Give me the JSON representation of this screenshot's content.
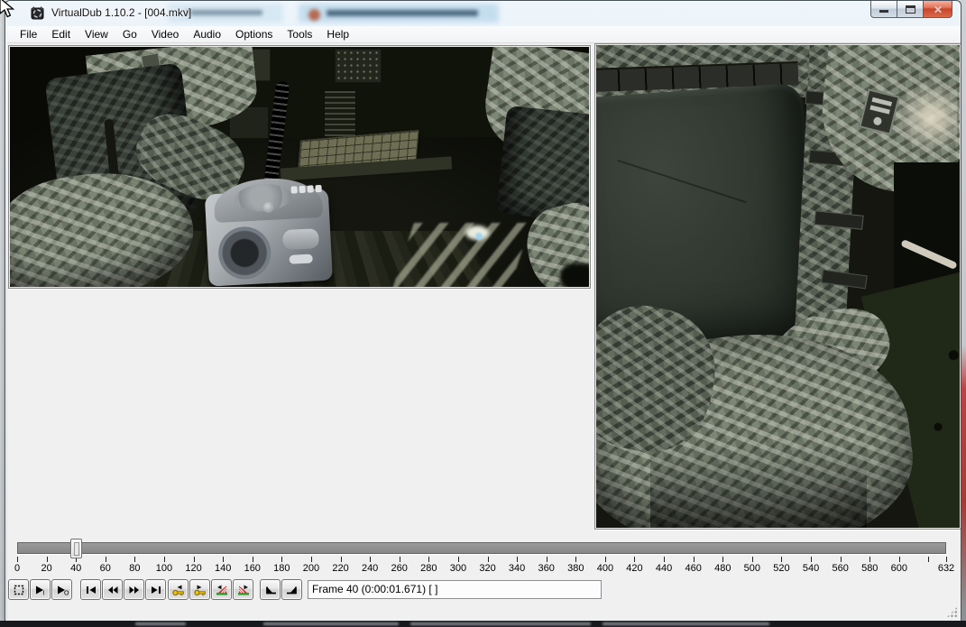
{
  "window": {
    "title": "VirtualDub 1.10.2 - [004.mkv]",
    "controls": {
      "minimize": "Minimize",
      "maximize": "Maximize",
      "close": "Close"
    }
  },
  "menu": {
    "items": [
      "File",
      "Edit",
      "View",
      "Go",
      "Video",
      "Audio",
      "Options",
      "Tools",
      "Help"
    ]
  },
  "timeline": {
    "current_frame": 40,
    "first_frame": 0,
    "last_frame": 632,
    "tick_step": 20,
    "last_step_label": 600,
    "end_label": "632"
  },
  "toolbar": {
    "groups": [
      [
        {
          "name": "stop",
          "icon": "stop-icon"
        },
        {
          "name": "play-input",
          "icon": "play-input-icon",
          "glyph": "I"
        },
        {
          "name": "play-output",
          "icon": "play-output-icon",
          "glyph": "O"
        }
      ],
      [
        {
          "name": "go-to-start",
          "icon": "go-start-icon"
        },
        {
          "name": "step-backward",
          "icon": "step-back-icon"
        },
        {
          "name": "step-forward",
          "icon": "step-forward-icon"
        },
        {
          "name": "go-to-end",
          "icon": "go-end-icon"
        }
      ],
      [
        {
          "name": "previous-keyframe",
          "icon": "key-back-icon"
        },
        {
          "name": "next-keyframe",
          "icon": "key-forward-icon"
        }
      ],
      [
        {
          "name": "previous-scene",
          "icon": "scene-back-icon"
        },
        {
          "name": "next-scene",
          "icon": "scene-forward-icon"
        }
      ],
      [
        {
          "name": "mark-in",
          "icon": "mark-in-icon"
        },
        {
          "name": "mark-out",
          "icon": "mark-out-icon"
        }
      ]
    ]
  },
  "statusbar": {
    "text": "Frame 40 (0:00:01.671) [ ]"
  },
  "colors": {
    "titlebar_glass": "#dce9f5",
    "client_bg": "#f0f0f0",
    "close_button_red": "#c8452a",
    "timeline_track": "#8f8f8f",
    "keyframe_key_yellow": "#f2c500",
    "scene_green": "#27a327",
    "scene_red": "#cc2f2f"
  }
}
